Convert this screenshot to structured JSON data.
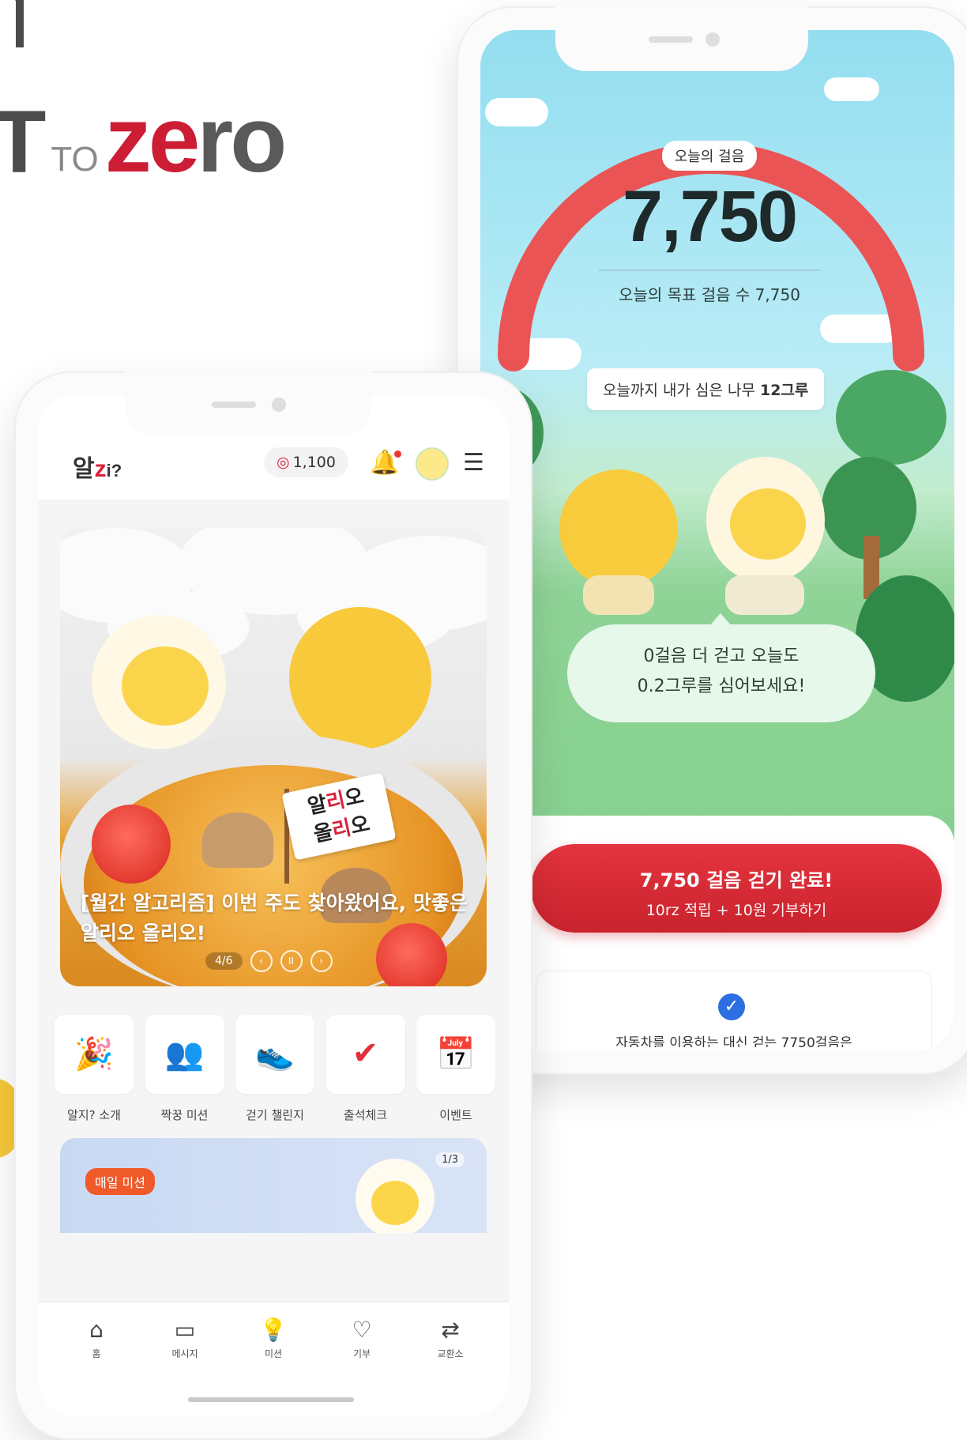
{
  "logo": {
    "part1": "T",
    "part2": "TO",
    "part3": "ze",
    "part4": "ro"
  },
  "right_phone": {
    "today_steps_label": "오늘의 걸음",
    "today_steps": "7,750",
    "goal_text": "오늘의 목표 걸음 수 7,750",
    "trees_text": "오늘까지 내가 심은 나무 ",
    "trees_value": "12그루",
    "speech_line1": "0걸음 더 걷고 오늘도",
    "speech_line2": "0.2그루를 심어보세요!",
    "complete_title": "7,750 걸음 걷기 완료!",
    "complete_sub": "10rz 적립 + 10원 기부하기",
    "auto_text": "자동차를 이용하는 대신 걷는 7750걸음은",
    "verify_icon": "check-badge-icon",
    "gauge_color": "#ea5455"
  },
  "left_phone": {
    "brand": {
      "prefix": "알",
      "accent": "z",
      "suffix": "i?"
    },
    "points": "1,100",
    "banner": {
      "flag_line1_a": "알",
      "flag_line1_b": "리",
      "flag_line1_c": "오",
      "flag_line2_a": "올",
      "flag_line2_b": "리",
      "flag_line2_c": "오",
      "caption": "[월간 알고리즘] 이번 주도 찾아왔어요, 맛좋은 알리오 올리오!",
      "page": "4/6",
      "prev": "‹",
      "pause": "II",
      "next": "›"
    },
    "quick_menu": [
      {
        "label": "알지? 소개",
        "icon": "party-popper-icon",
        "glyph": "🎉"
      },
      {
        "label": "짝꿍 미션",
        "icon": "people-icon",
        "glyph": "👥"
      },
      {
        "label": "걷기 챌린지",
        "icon": "sneakers-icon",
        "glyph": "👟"
      },
      {
        "label": "출석체크",
        "icon": "check-icon",
        "glyph": "✔"
      },
      {
        "label": "이벤트",
        "icon": "calendar-icon",
        "glyph": "📅"
      }
    ],
    "mission": {
      "badge": "매일 미션",
      "page": "1/3"
    },
    "tabs": [
      {
        "label": "홈",
        "icon": "home-icon",
        "glyph": "⌂"
      },
      {
        "label": "메시지",
        "icon": "message-icon",
        "glyph": "▭"
      },
      {
        "label": "미션",
        "icon": "lightbulb-icon",
        "glyph": "💡"
      },
      {
        "label": "기부",
        "icon": "heart-icon",
        "glyph": "♡"
      },
      {
        "label": "교환소",
        "icon": "exchange-icon",
        "glyph": "⇄"
      }
    ],
    "accent_color": "#d9213a"
  }
}
